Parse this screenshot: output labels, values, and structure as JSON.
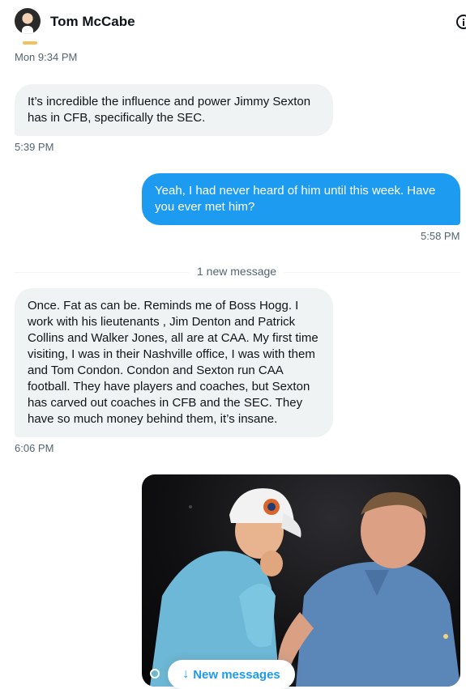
{
  "header": {
    "name": "Tom McCabe"
  },
  "messages": [
    {
      "type": "timestamp",
      "text": "Mon 9:34 PM"
    },
    {
      "type": "received",
      "text": "It’s incredible the influence and power Jimmy Sexton has in CFB, specifically the SEC.",
      "time": "5:39 PM"
    },
    {
      "type": "sent",
      "text": "Yeah, I had never heard of him until this week.  Have you ever met him?",
      "time": "5:58 PM"
    },
    {
      "type": "divider",
      "text": "1 new message"
    },
    {
      "type": "received",
      "text": "Once. Fat as can be. Reminds me of Boss Hogg. I work with his lieutenants , Jim Denton and Patrick Collins and Walker Jones, all are at CAA. My first time visiting, I was in their Nashville office, I was with them and Tom Condon. Condon and Sexton run CAA football. They have players and coaches, but Sexton has carved out coaches in CFB and the SEC. They have so much money behind them, it’s insane.",
      "time": "6:06 PM"
    }
  ],
  "photo": {
    "description_icon": "image-icon"
  },
  "new_messages_button": {
    "arrow": "↓",
    "label": "New messages"
  },
  "colors": {
    "accent": "#1d9bf0",
    "received_bubble": "#eff3f4",
    "secondary_text": "#536471"
  }
}
